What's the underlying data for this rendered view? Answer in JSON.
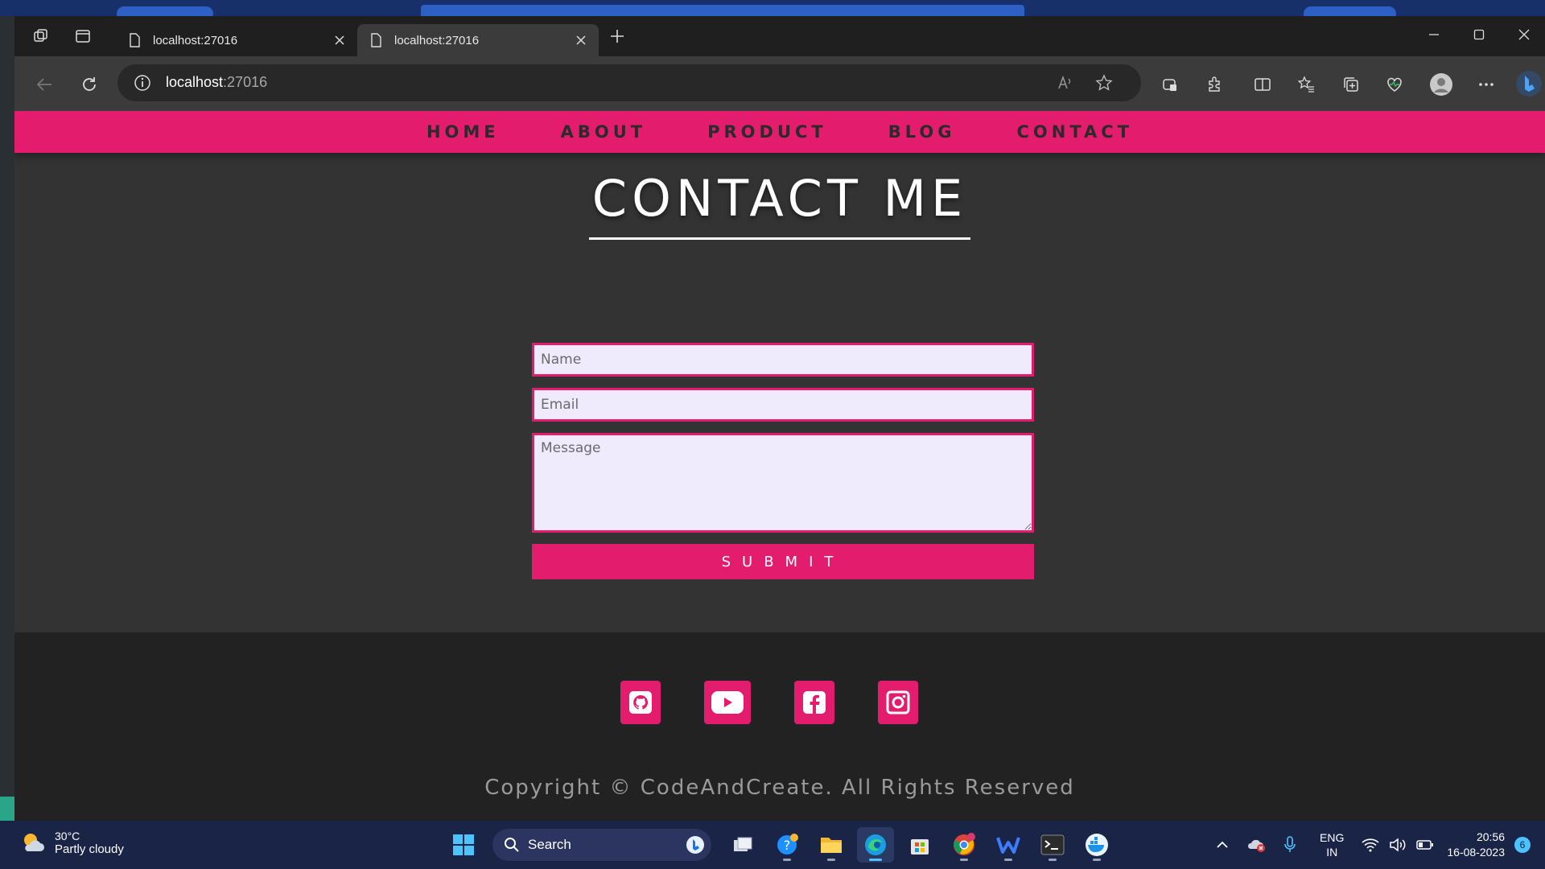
{
  "browser": {
    "tabs": [
      {
        "title": "localhost:27016",
        "active": false
      },
      {
        "title": "localhost:27016",
        "active": true
      }
    ],
    "address": {
      "host": "localhost",
      "port": ":27016"
    }
  },
  "nav": {
    "items": [
      "HOME",
      "ABOUT",
      "PRODUCT",
      "BLOG",
      "CONTACT"
    ]
  },
  "contact": {
    "title": "CONTACT ME",
    "name_placeholder": "Name",
    "email_placeholder": "Email",
    "message_placeholder": "Message",
    "submit_label": "SUBMIT"
  },
  "footer": {
    "socials": [
      "github-icon",
      "youtube-icon",
      "facebook-icon",
      "instagram-icon"
    ],
    "copyright": "Copyright © CodeAndCreate. All Rights Reserved"
  },
  "taskbar": {
    "weather_temp": "30°C",
    "weather_condition": "Partly cloudy",
    "search_label": "Search",
    "lang_line1": "ENG",
    "lang_line2": "IN",
    "time": "20:56",
    "date": "16-08-2023",
    "notification_count": "6"
  },
  "colors": {
    "accent": "#e31c6e",
    "page_bg": "#333333",
    "footer_bg": "#222222",
    "input_bg": "#efeafc"
  }
}
